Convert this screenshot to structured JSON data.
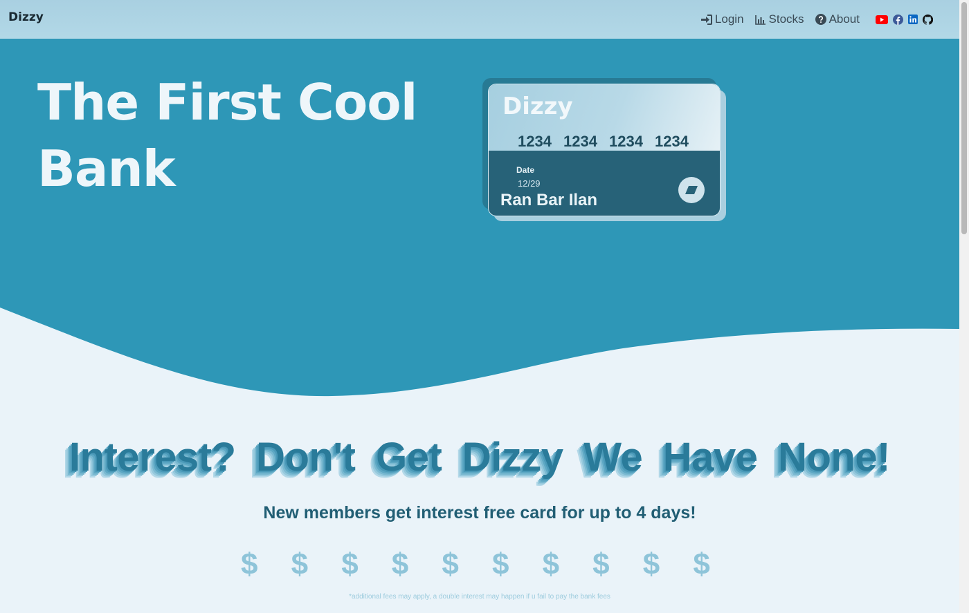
{
  "navbar": {
    "brand": "Dizzy",
    "links": [
      {
        "label": "Login",
        "icon": "sign-in-icon"
      },
      {
        "label": "Stocks",
        "icon": "bar-chart-icon"
      },
      {
        "label": "About",
        "icon": "question-circle-icon"
      }
    ],
    "social": [
      {
        "name": "youtube-icon",
        "color": "#ff0000"
      },
      {
        "name": "facebook-icon",
        "color": "#3b5998"
      },
      {
        "name": "linkedin-icon",
        "color": "#0a66c2"
      },
      {
        "name": "github-icon",
        "color": "#111111"
      }
    ]
  },
  "hero": {
    "title_line1": "The First Cool",
    "title_line2": "Bank",
    "background": "#2e97b7"
  },
  "card": {
    "brand": "Dizzy",
    "number_groups": [
      "1234",
      "1234",
      "1234",
      "1234"
    ],
    "date_label": "Date",
    "date": "12/29",
    "holder": "Ran Bar Ilan"
  },
  "main": {
    "headline": "Interest? Don't Get Dizzy We Have None!",
    "subline": "New members get interest free card for up to 4 days!",
    "dollar_sign": "$",
    "dollar_count": 10,
    "disclaimer": "*additional fees may apply, a double interest may happen if u fail to pay the bank fees"
  }
}
